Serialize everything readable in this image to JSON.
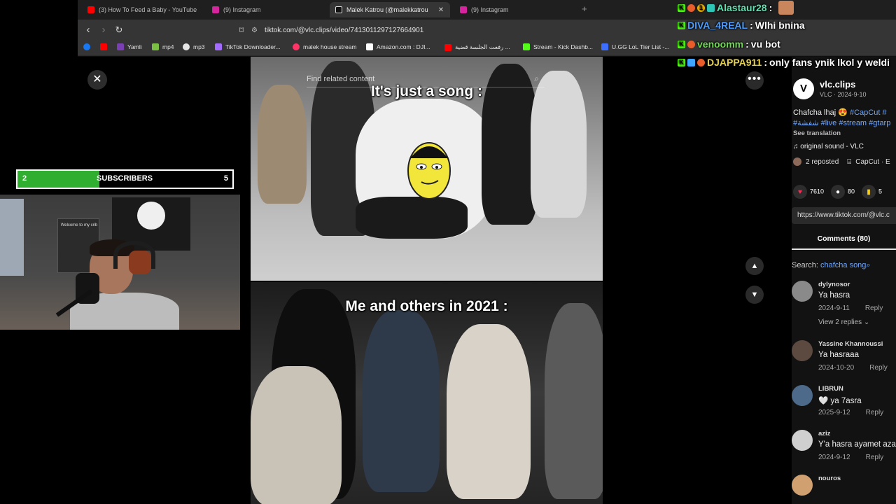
{
  "tabs": [
    {
      "label": "(3) How To Feed a Baby - YouTube",
      "icon": "youtube-icon",
      "color": "#ff0000"
    },
    {
      "label": "(9) Instagram",
      "icon": "instagram-icon",
      "color": "#d6249f"
    },
    {
      "label": "Malek Katrou (@malekkatrou",
      "icon": "tiktok-icon",
      "color": "#ffffff",
      "active": true
    },
    {
      "label": "(9) Instagram",
      "icon": "instagram-icon",
      "color": "#d6249f"
    }
  ],
  "new_tab": "+",
  "nav": {
    "url": "tiktok.com/@vlc.clips/video/7413011297127664901"
  },
  "bookmarks": [
    {
      "label": "",
      "icon": "facebook-icon",
      "color": "#1877f2"
    },
    {
      "label": "",
      "icon": "youtube-icon",
      "color": "#ff0000"
    },
    {
      "label": "Yamli",
      "icon": "yamli-icon",
      "color": "#7a3fb3"
    },
    {
      "label": "mp4",
      "icon": "download-icon",
      "color": "#7bc043"
    },
    {
      "label": "mp3",
      "icon": "mp3-icon",
      "color": "#e6e6e6"
    },
    {
      "label": "TikTok Downloader...",
      "icon": "tiktok-downloader-icon",
      "color": "#a36bff"
    },
    {
      "label": "malek house stream",
      "icon": "stream-icon",
      "color": "#ff3366"
    },
    {
      "label": "Amazon.com : DJI...",
      "icon": "amazon-icon",
      "color": "#ffffff"
    },
    {
      "label": "رفعت الجلسة قضية ...",
      "icon": "youtube-icon",
      "color": "#ff0000"
    },
    {
      "label": "Stream - Kick Dashb...",
      "icon": "kick-icon",
      "color": "#53fc18"
    },
    {
      "label": "U.GG LoL Tier List -...",
      "icon": "ugg-icon",
      "color": "#3d6fff"
    }
  ],
  "video": {
    "search_placeholder": "Find related content",
    "caption_top": "It's just a song :",
    "caption_bottom": "Me and others in 2021 :"
  },
  "close_label": "✕",
  "more_label": "•••",
  "info": {
    "avatar_letter": "V",
    "author": "vlc.clips",
    "meta": "VLC · 2024-9-10",
    "desc_line1_text": "Chafcha lhaj 😍 ",
    "desc_line1_tags": "#CapCut #",
    "desc_line2": "#شفشة #live #stream #gtarp",
    "see_translation": "See translation",
    "sound": "original sound - VLC",
    "reposted": "2 reposted",
    "capcut": "CapCut · E",
    "likes": "7610",
    "comments_count": "80",
    "saves": "5",
    "link": "https://www.tiktok.com/@vlc.c",
    "comments_tab": "Comments (80)",
    "search_prefix": "Search:",
    "search_query": "chafcha song"
  },
  "comments": [
    {
      "user": "dylynosor",
      "text": "Ya hasra",
      "date": "2024-9-11",
      "reply": "Reply",
      "view_replies": "View 2 replies",
      "color": "#8a8a8a"
    },
    {
      "user": "Yassine Khannoussi",
      "text": "Ya hasraaa",
      "date": "2024-10-20",
      "reply": "Reply",
      "color": "#5c4a40"
    },
    {
      "user": "LIBRUN",
      "text": "🤍 ya 7asra",
      "date": "2025-9-12",
      "reply": "Reply",
      "color": "#4d6a8a"
    },
    {
      "user": "aziz",
      "text": "Y'a hasra ayamet aza",
      "date": "2024-9-12",
      "reply": "Reply",
      "color": "#cfcfcf"
    },
    {
      "user": "nouros",
      "color": "#d0a070"
    }
  ],
  "subscribers": {
    "current": "2",
    "label": "SUBSCRIBERS",
    "goal": "5",
    "progress": 0.38
  },
  "webcam": {
    "poster_text": "Welcome to my crib"
  },
  "chat": [
    {
      "user": "Alastaur28",
      "sep": " :",
      "msg": "",
      "color": "#5fe0b0"
    },
    {
      "user": "DIVA_4REAL",
      "sep": " :",
      "msg": " Wlhi bnina",
      "color": "#4a9dff"
    },
    {
      "user": "venoomm",
      "sep": " :",
      "msg": " vu bot",
      "color": "#6fdc52"
    },
    {
      "user": "DJAPPA911",
      "sep": " :",
      "msg": " only fans ynik lkol y weldi",
      "color": "#e8d24a"
    }
  ]
}
